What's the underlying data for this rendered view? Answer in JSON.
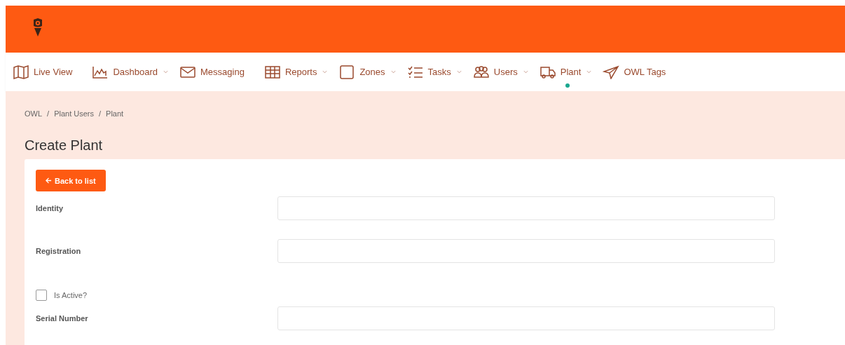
{
  "nav": [
    {
      "label": "Live View",
      "kind": "map",
      "dropdown": false,
      "selected": false
    },
    {
      "label": "Dashboard",
      "kind": "chart",
      "dropdown": true,
      "selected": false
    },
    {
      "label": "Messaging",
      "kind": "mail",
      "dropdown": false,
      "selected": false
    },
    {
      "label": "Reports",
      "kind": "table",
      "dropdown": true,
      "selected": false
    },
    {
      "label": "Zones",
      "kind": "square",
      "dropdown": true,
      "selected": false
    },
    {
      "label": "Tasks",
      "kind": "list",
      "dropdown": true,
      "selected": false
    },
    {
      "label": "Users",
      "kind": "users",
      "dropdown": true,
      "selected": false
    },
    {
      "label": "Plant",
      "kind": "truck",
      "dropdown": true,
      "selected": true
    },
    {
      "label": "OWL Tags",
      "kind": "send",
      "dropdown": false,
      "selected": false
    }
  ],
  "breadcrumb": [
    "OWL",
    "Plant Users",
    "Plant"
  ],
  "breadcrumb_separator": "/",
  "page_title": "Create Plant",
  "back_button": "Back to list",
  "fields": [
    {
      "kind": "text",
      "label": "Identity"
    },
    {
      "kind": "text",
      "label": "Registration"
    },
    {
      "kind": "checkbox",
      "label": "Is Active?",
      "checked": false
    },
    {
      "kind": "text",
      "label": "Serial Number"
    }
  ]
}
